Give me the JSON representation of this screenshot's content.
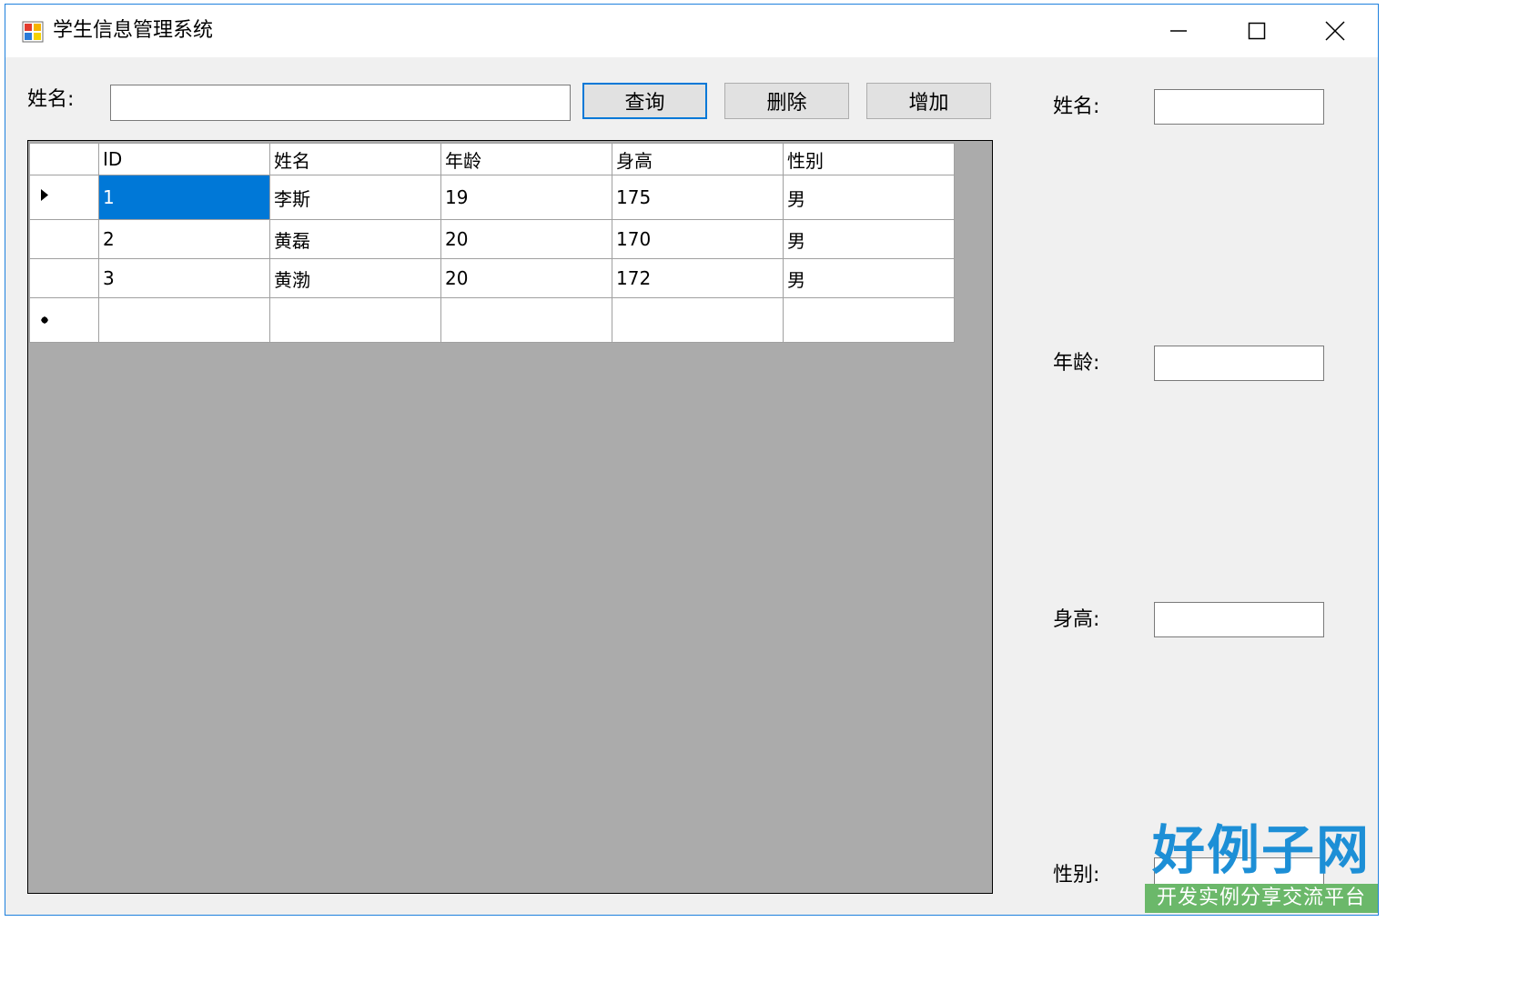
{
  "window": {
    "title": "学生信息管理系统",
    "minimize_icon": "minimize-icon",
    "maximize_icon": "maximize-icon",
    "close_icon": "close-icon"
  },
  "search": {
    "name_label": "姓名:",
    "name_value": "",
    "query_button": "查询",
    "delete_button": "删除",
    "add_button": "增加"
  },
  "grid": {
    "columns": [
      "ID",
      "姓名",
      "年龄",
      "身高",
      "性别"
    ],
    "rows": [
      [
        "1",
        "李斯",
        "19",
        "175",
        "男"
      ],
      [
        "2",
        "黄磊",
        "20",
        "170",
        "男"
      ],
      [
        "3",
        "黄渤",
        "20",
        "172",
        "男"
      ]
    ],
    "selected_row_index": 0,
    "current_row_icon": "row-pointer-icon",
    "new_row_icon": "new-row-icon"
  },
  "details": {
    "name_label": "姓名:",
    "age_label": "年龄:",
    "height_label": "身高:",
    "gender_label": "性别:",
    "name_value": "",
    "age_value": "",
    "height_value": "",
    "gender_value": ""
  },
  "watermark": {
    "brand": "好例子网",
    "tagline": "开发实例分享交流平台"
  },
  "colors": {
    "accent": "#0078d7",
    "grid_background": "#ababab",
    "window_border": "#1e80dd"
  }
}
